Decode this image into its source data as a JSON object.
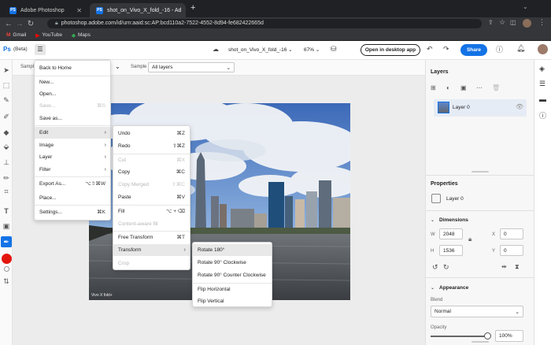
{
  "browser": {
    "tabs": [
      {
        "label": "Adobe Photoshop",
        "favicon": "PS"
      },
      {
        "label": "shot_on_Vivo_X_fold_-16 - Ad",
        "favicon": "PS"
      }
    ],
    "new_tab": "+",
    "url": "photoshop.adobe.com/id/urn:aaid:sc:AP:bcd110a2-7522-4552-8d94-fe682422665d",
    "bookmarks": [
      "Gmail",
      "YouTube",
      "Maps"
    ]
  },
  "app": {
    "logo": "Ps",
    "beta": "(Beta)",
    "doc_name": "shot_on_Vivo_X_fold_-16",
    "zoom": "67%",
    "open_desktop": "Open in desktop app",
    "share": "Share"
  },
  "options": {
    "sample_label": "Sample",
    "sample2_label": "Sample",
    "sample_value": "All layers"
  },
  "file_menu": {
    "items": [
      {
        "label": "Back to Home",
        "shortcut": ""
      },
      {
        "label": "New...",
        "shortcut": ""
      },
      {
        "label": "Open...",
        "shortcut": ""
      },
      {
        "label": "Save...",
        "shortcut": "⌘S",
        "disabled": true
      },
      {
        "label": "Save as...",
        "shortcut": ""
      },
      {
        "label": "Edit",
        "submenu": true
      },
      {
        "label": "Image",
        "submenu": true
      },
      {
        "label": "Layer",
        "submenu": true
      },
      {
        "label": "Filter",
        "submenu": true
      },
      {
        "label": "Export As...",
        "shortcut": "⌥⇧⌘W"
      },
      {
        "label": "Place...",
        "shortcut": ""
      },
      {
        "label": "Settings...",
        "shortcut": "⌘K"
      }
    ],
    "arrow": "›"
  },
  "edit_menu": {
    "items": [
      {
        "label": "Undo",
        "shortcut": "⌘Z"
      },
      {
        "label": "Redo",
        "shortcut": "⇧⌘Z"
      },
      {
        "label": "Cut",
        "shortcut": "⌘X",
        "disabled": true
      },
      {
        "label": "Copy",
        "shortcut": "⌘C"
      },
      {
        "label": "Copy Merged",
        "shortcut": "⇧⌘C",
        "disabled": true
      },
      {
        "label": "Paste",
        "shortcut": "⌘V"
      },
      {
        "label": "Fill",
        "shortcut": "⌥ + ⌫"
      },
      {
        "label": "Content-aware fill",
        "shortcut": "",
        "disabled": true
      },
      {
        "label": "Free Transform",
        "shortcut": "⌘T"
      },
      {
        "label": "Transform",
        "submenu": true
      },
      {
        "label": "Crop",
        "shortcut": "",
        "disabled": true
      }
    ]
  },
  "transform_menu": {
    "items": [
      "Rotate 180°",
      "Rotate 90° Clockwise",
      "Rotate 90° Counter Clockwise",
      "Flip Horizontal",
      "Flip Vertical"
    ]
  },
  "layers": {
    "title": "Layers",
    "layer_name": "Layer 0"
  },
  "properties": {
    "title": "Properties",
    "layer_name": "Layer 0",
    "dimensions_label": "Dimensions",
    "w_label": "W",
    "w_value": "2048",
    "h_label": "H",
    "h_value": "1536",
    "x_label": "X",
    "x_value": "0",
    "y_label": "Y",
    "y_value": "0",
    "appearance_label": "Appearance",
    "blend_label": "Blend",
    "blend_value": "Normal",
    "opacity_label": "Opacity",
    "opacity_value": "100%"
  },
  "photo_credit": "Vivo X fold+",
  "colors": {
    "accent": "#1473e6",
    "foreground": "#e3160d"
  }
}
